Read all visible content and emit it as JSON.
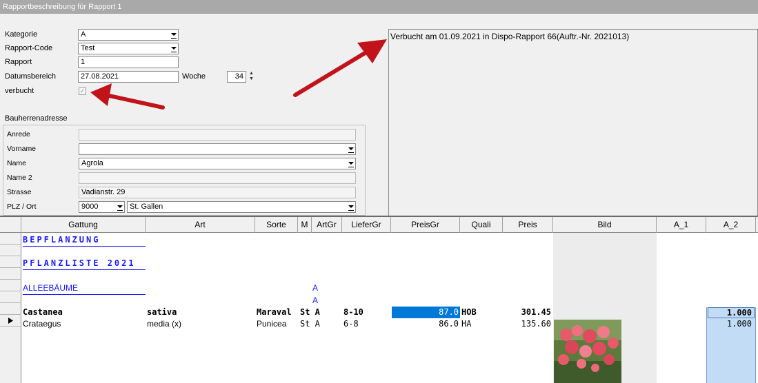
{
  "window": {
    "title": "Rapportbeschreibung für Rapport 1"
  },
  "form": {
    "kategorie": {
      "label": "Kategorie",
      "value": "A"
    },
    "rapport_code": {
      "label": "Rapport-Code",
      "value": "Test"
    },
    "rapport": {
      "label": "Rapport",
      "value": "1"
    },
    "datumsbereich": {
      "label": "Datumsbereich",
      "value": "27.08.2021"
    },
    "woche": {
      "label": "Woche",
      "value": "34"
    },
    "verbucht": {
      "label": "verbucht",
      "checked": true
    }
  },
  "bauherr": {
    "section_label": "Bauherrenadresse",
    "anrede": {
      "label": "Anrede",
      "value": ""
    },
    "vorname": {
      "label": "Vorname",
      "value": ""
    },
    "name": {
      "label": "Name",
      "value": "Agrola"
    },
    "name2": {
      "label": "Name 2",
      "value": ""
    },
    "strasse": {
      "label": "Strasse",
      "value": "Vadianstr. 29"
    },
    "plz_ort": {
      "label": "PLZ / Ort",
      "plz": "9000",
      "ort": "St. Gallen"
    }
  },
  "memo": {
    "text": "Verbucht am 01.09.2021 in Dispo-Rapport 66(Auftr.-Nr. 2021013)"
  },
  "grid": {
    "columns": [
      "Gattung",
      "Art",
      "Sorte",
      "M",
      "ArtGr",
      "LieferGr",
      "PreisGr",
      "Quali",
      "Preis",
      "Bild",
      "A_1",
      "A_2"
    ],
    "section1": "BEPFLANZUNG",
    "section2": "PFLANZLISTE 2021",
    "group1": "ALLEEBÄUME",
    "group1_artgr": "A",
    "group1_artgr2": "A",
    "rows": [
      {
        "gattung": "Castanea",
        "art": "sativa",
        "sorte": "Maraval",
        "artgr": "St A",
        "liefergr": "8-10",
        "preisgr": "87.0",
        "quali": "HOB",
        "preis": "301.45",
        "a2": "1.000"
      },
      {
        "gattung": "Crataegus",
        "art": "media (x)",
        "sorte": "Punicea",
        "artgr": "St A",
        "liefergr": "6-8",
        "preisgr": "86.0",
        "quali": "HA",
        "preis": "135.60",
        "a2": "1.000"
      }
    ]
  },
  "colors": {
    "accent": "#c0141a",
    "selection": "#0078d7",
    "section_text": "#1a1aff"
  }
}
